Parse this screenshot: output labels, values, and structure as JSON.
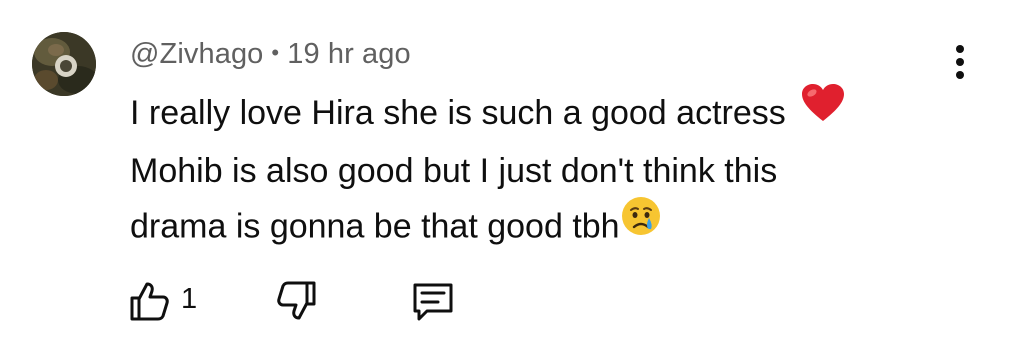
{
  "comment": {
    "author": "@Zivhago",
    "separator": "•",
    "timestamp": "19 hr ago",
    "lines": [
      "I really love Hira she is such a good actress",
      "Mohib is also good but I just don't think this",
      "drama is gonna be that good tbh"
    ],
    "emojis": [
      "red-heart",
      "crying-face"
    ]
  },
  "actions": {
    "like_count": "1",
    "icons": [
      "thumbs-up-icon",
      "thumbs-down-icon",
      "reply-comment-icon",
      "more-vertical-icon"
    ]
  },
  "colors": {
    "meta_text": "#606060",
    "body_text": "#0f0f0f",
    "heart": "#e0202e",
    "emoji_face": "#f7c531",
    "tear": "#3aa0e8"
  }
}
